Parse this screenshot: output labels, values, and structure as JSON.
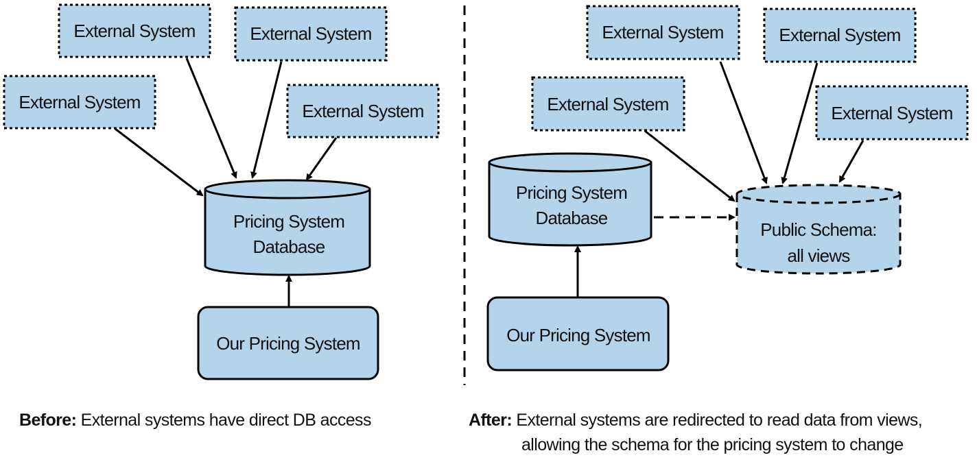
{
  "colors": {
    "fill": "#b3d4ea",
    "stroke": "#000000"
  },
  "before": {
    "external_systems": [
      "External System",
      "External System",
      "External System",
      "External System"
    ],
    "database": [
      "Pricing System",
      "Database"
    ],
    "service": "Our Pricing System",
    "caption_bold": "Before:",
    "caption": " External systems have direct DB access"
  },
  "after": {
    "external_systems": [
      "External System",
      "External System",
      "External System",
      "External System"
    ],
    "database": [
      "Pricing System",
      "Database"
    ],
    "public_schema": [
      "Public Schema:",
      "all views"
    ],
    "service": "Our Pricing System",
    "caption_bold": "After:",
    "caption_line1": " External systems are redirected to read data from views,",
    "caption_line2": "allowing the schema for the pricing system to change"
  }
}
